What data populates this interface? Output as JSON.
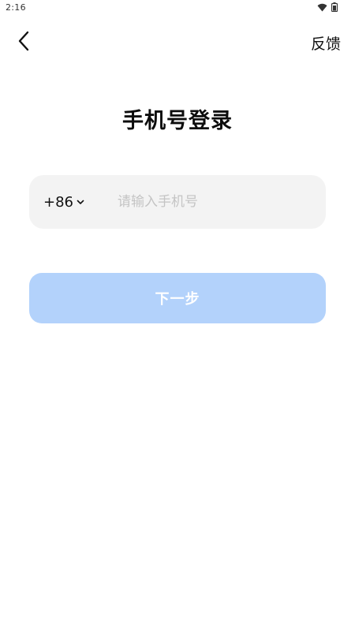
{
  "status_bar": {
    "time": "2:16",
    "icons": [
      "wifi-icon",
      "battery-icon"
    ]
  },
  "nav": {
    "back_icon": "chevron-left-icon",
    "feedback_label": "反馈"
  },
  "page": {
    "title": "手机号登录"
  },
  "phone_input": {
    "country_code": "+86",
    "country_code_icon": "chevron-down-icon",
    "value": "",
    "placeholder": "请输入手机号"
  },
  "next_button": {
    "label": "下一步"
  },
  "colors": {
    "input_background": "#f3f3f3",
    "button_background": "#b3d2fb",
    "button_text": "#ffffff",
    "placeholder": "#c4c4c4"
  }
}
